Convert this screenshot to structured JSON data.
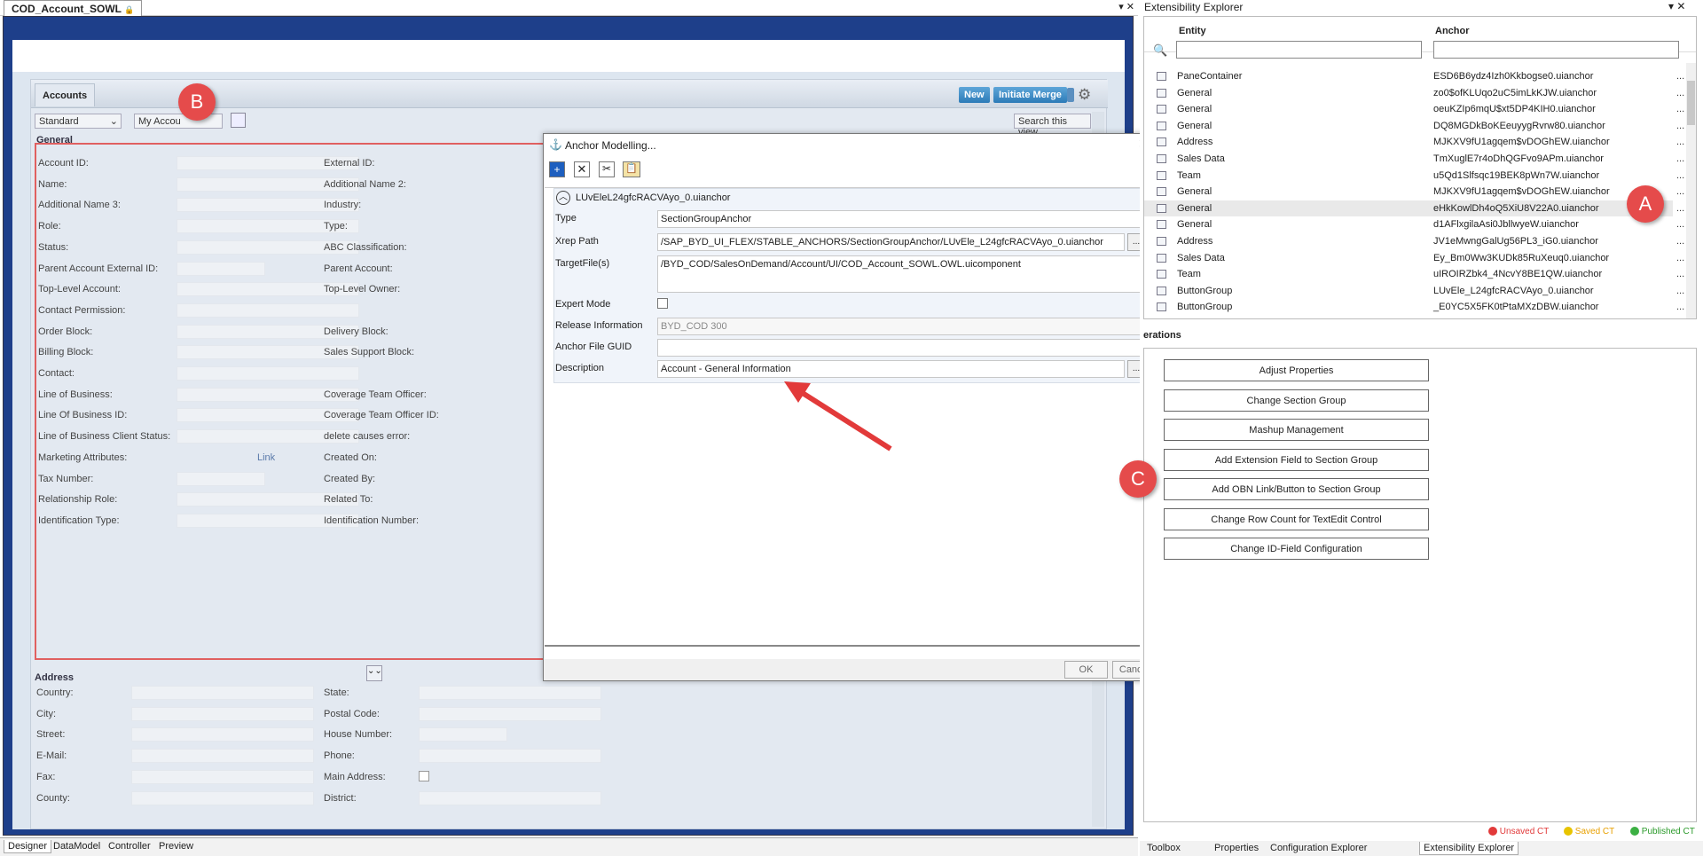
{
  "doc_tab": {
    "title": "COD_Account_SOWL"
  },
  "accounts": {
    "tab_label": "Accounts",
    "new_label": "New",
    "merge_label": "Initiate Merge",
    "view_select": "Standard",
    "my_accounts": "My Accou",
    "search_view": "Search this view"
  },
  "general": {
    "title": "General",
    "left": [
      "Account ID:",
      "Name:",
      "Additional Name 3:",
      "Role:",
      "Status:",
      "Parent Account External ID:",
      "Top-Level Account:",
      "Contact Permission:",
      "Order Block:",
      "Billing Block:",
      "Contact:",
      "Line of Business:",
      "Line Of Business ID:",
      "Line of Business Client Status:",
      "Marketing Attributes:",
      "Tax Number:",
      "Relationship Role:",
      "Identification Type:"
    ],
    "right": [
      "External ID:",
      "Additional Name 2:",
      "Industry:",
      "Type:",
      "ABC Classification:",
      "Parent Account:",
      "Top-Level Owner:",
      "",
      "Delivery Block:",
      "Sales Support Block:",
      "",
      "Coverage Team Officer:",
      "Coverage Team Officer ID:",
      "delete causes error:",
      "Created On:",
      "Created By:",
      "Related To:",
      "Identification Number:"
    ],
    "link_label": "Link"
  },
  "address": {
    "title": "Address",
    "left": [
      "Country:",
      "City:",
      "Street:",
      "E-Mail:",
      "Fax:",
      "County:"
    ],
    "right": [
      "State:",
      "Postal Code:",
      "House Number:",
      "Phone:",
      "Main Address:",
      "District:"
    ]
  },
  "dialog": {
    "title": "Anchor Modelling...",
    "anchor_name": "LUvEleL24gfcRACVAyo_0.uianchor",
    "rows": [
      {
        "label": "Type",
        "value": "SectionGroupAnchor"
      },
      {
        "label": "Xrep Path",
        "value": "/SAP_BYD_UI_FLEX/STABLE_ANCHORS/SectionGroupAnchor/LUvEle_L24gfcRACVAyo_0.uianchor"
      },
      {
        "label": "TargetFile(s)",
        "value": "/BYD_COD/SalesOnDemand/Account/UI/COD_Account_SOWL.OWL.uicomponent"
      },
      {
        "label": "Expert Mode",
        "value": ""
      },
      {
        "label": "Release Information",
        "value": "BYD_COD 300"
      },
      {
        "label": "Anchor File GUID",
        "value": ""
      },
      {
        "label": "Description",
        "value": "Account - General Information"
      }
    ],
    "ok_label": "OK",
    "cancel_label": "Cancel",
    "ellipsis": "..."
  },
  "explorer": {
    "title": "Extensibility Explorer",
    "col_entity": "Entity",
    "col_anchor": "Anchor",
    "rows": [
      {
        "entity": "PaneContainer",
        "anchor": "ESD6B6ydz4Izh0Kkbogse0.uianchor"
      },
      {
        "entity": "General",
        "anchor": "zo0$ofKLUqo2uC5imLkKJW.uianchor"
      },
      {
        "entity": "General",
        "anchor": "oeuKZIp6mqU$xt5DP4KIH0.uianchor"
      },
      {
        "entity": "General",
        "anchor": "DQ8MGDkBoKEeuyygRvrw80.uianchor"
      },
      {
        "entity": "Address",
        "anchor": "MJKXV9fU1agqem$vDOGhEW.uianchor"
      },
      {
        "entity": "Sales Data",
        "anchor": "TmXuglE7r4oDhQGFvo9APm.uianchor"
      },
      {
        "entity": "Team",
        "anchor": "u5Qd1Slfsqc19BEK8pWn7W.uianchor"
      },
      {
        "entity": "General",
        "anchor": "MJKXV9fU1agqem$vDOGhEW.uianchor"
      },
      {
        "entity": "General",
        "anchor": "eHkKowlDh4oQ5XiU8V22A0.uianchor"
      },
      {
        "entity": "General",
        "anchor": "d1AFlxgilaAsi0JbllwyeW.uianchor"
      },
      {
        "entity": "Address",
        "anchor": "JV1eMwngGalUg56PL3_iG0.uianchor"
      },
      {
        "entity": "Sales Data",
        "anchor": "Ey_Bm0Ww3KUDk85RuXeuq0.uianchor"
      },
      {
        "entity": "Team",
        "anchor": "uIROIRZbk4_4NcvY8BE1QW.uianchor"
      },
      {
        "entity": "ButtonGroup",
        "anchor": "LUvEle_L24gfcRACVAyo_0.uianchor"
      },
      {
        "entity": "ButtonGroup",
        "anchor": "_E0YC5X5FK0tPtaMXzDBW.uianchor"
      }
    ],
    "operations_label": "erations",
    "operations": [
      "Adjust Properties",
      "Change Section Group",
      "Mashup Management",
      "Add Extension Field to Section Group",
      "Add OBN Link/Button to Section Group",
      "Change Row Count for TextEdit Control",
      "Change ID-Field Configuration"
    ],
    "legend": {
      "unsaved": "Unsaved CT",
      "saved": "Saved CT",
      "published": "Published CT"
    }
  },
  "bottom_tabs": [
    "Designer",
    "DataModel",
    "Controller",
    "Preview"
  ],
  "right_tabs": [
    "Toolbox",
    "Properties",
    "Configuration Explorer",
    "Extensibility Explorer"
  ],
  "badges": {
    "a": "A",
    "b": "B",
    "c": "C"
  }
}
